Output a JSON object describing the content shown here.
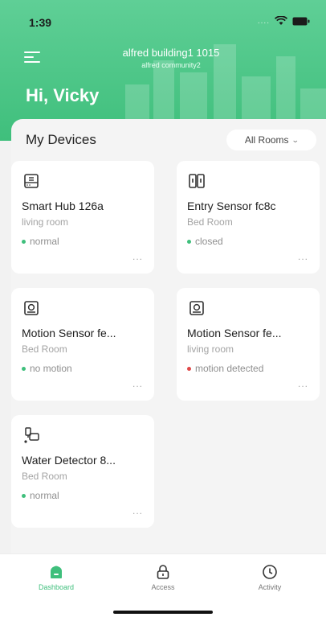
{
  "status_bar": {
    "time": "1:39",
    "signal": "...."
  },
  "header": {
    "building": "alfred building1 1015",
    "community": "alfred community2",
    "greeting": "Hi, Vicky"
  },
  "devices_section": {
    "title": "My Devices",
    "room_filter": "All Rooms"
  },
  "devices": [
    {
      "name": "Smart Hub 126a",
      "room": "living room",
      "status": "normal",
      "status_color": "#3fbf7c",
      "icon": "smart-hub-icon"
    },
    {
      "name": "Entry Sensor fc8c",
      "room": "Bed Room",
      "status": "closed",
      "status_color": "#3fbf7c",
      "icon": "entry-sensor-icon"
    },
    {
      "name": "Motion Sensor fe...",
      "room": "Bed Room",
      "status": "no motion",
      "status_color": "#3fbf7c",
      "icon": "motion-sensor-icon"
    },
    {
      "name": "Motion Sensor fe...",
      "room": "living room",
      "status": "motion detected",
      "status_color": "#e04848",
      "icon": "motion-sensor-icon"
    },
    {
      "name": "Water Detector 8...",
      "room": "Bed Room",
      "status": "normal",
      "status_color": "#3fbf7c",
      "icon": "water-detector-icon"
    }
  ],
  "more_label": "...",
  "tabs": [
    {
      "label": "Dashboard",
      "icon": "dashboard-icon",
      "active": true
    },
    {
      "label": "Access",
      "icon": "lock-icon",
      "active": false
    },
    {
      "label": "Activity",
      "icon": "clock-icon",
      "active": false
    }
  ],
  "colors": {
    "accent": "#3fbf7c",
    "alert": "#e04848",
    "header_green": "#4fc787"
  }
}
